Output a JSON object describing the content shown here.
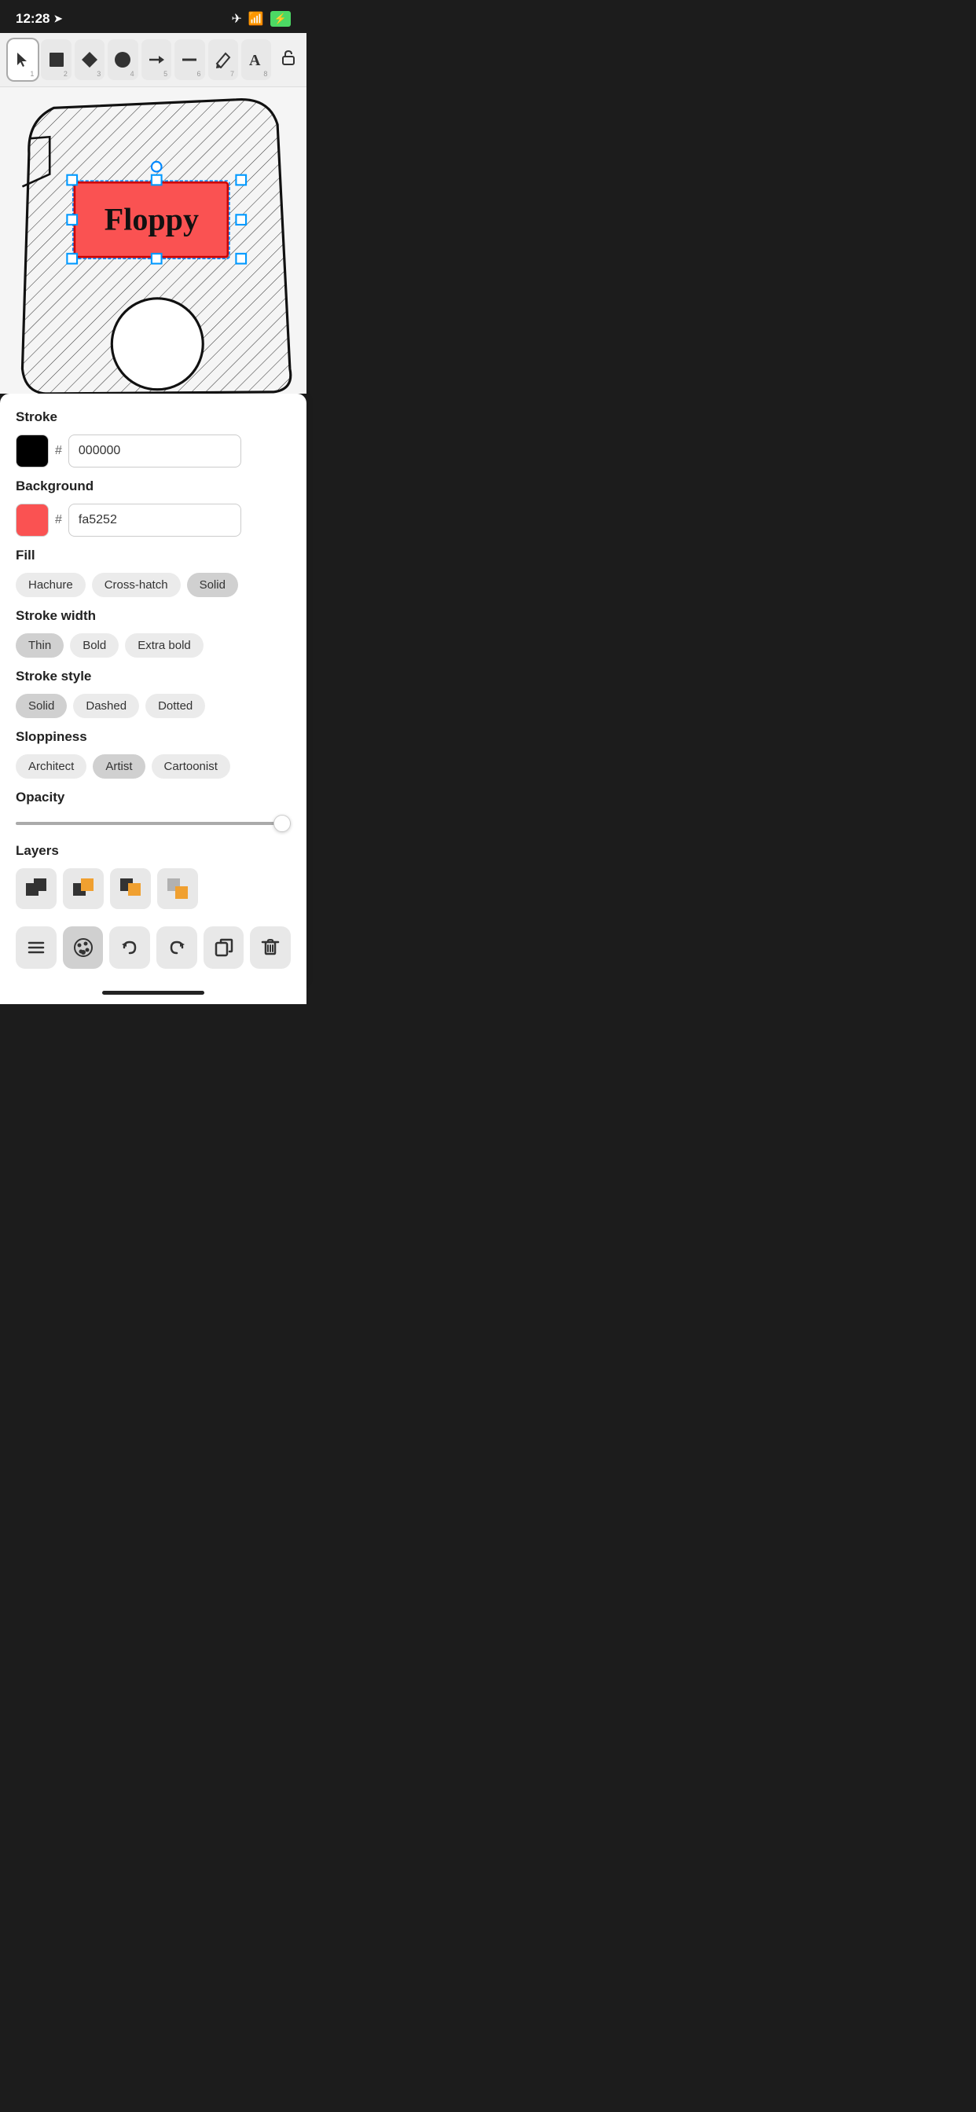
{
  "statusBar": {
    "time": "12:28",
    "locationArrow": "➤"
  },
  "toolbar": {
    "tools": [
      {
        "id": "select",
        "icon": "cursor",
        "num": "1",
        "active": true
      },
      {
        "id": "rect",
        "icon": "square",
        "num": "2"
      },
      {
        "id": "diamond",
        "icon": "diamond",
        "num": "3"
      },
      {
        "id": "ellipse",
        "icon": "circle",
        "num": "4"
      },
      {
        "id": "arrow",
        "icon": "arrow",
        "num": "5"
      },
      {
        "id": "line",
        "icon": "line",
        "num": "6"
      },
      {
        "id": "pencil",
        "icon": "pencil",
        "num": "7"
      },
      {
        "id": "text",
        "icon": "text",
        "num": "8"
      }
    ],
    "lock": "🔓"
  },
  "panel": {
    "stroke": {
      "label": "Stroke",
      "color": "#000000",
      "hex": "000000"
    },
    "background": {
      "label": "Background",
      "color": "#fa5252",
      "hex": "fa5252"
    },
    "fill": {
      "label": "Fill",
      "options": [
        "Hachure",
        "Cross-hatch",
        "Solid"
      ],
      "active": "Solid"
    },
    "strokeWidth": {
      "label": "Stroke width",
      "options": [
        "Thin",
        "Bold",
        "Extra bold"
      ],
      "active": "Thin"
    },
    "strokeStyle": {
      "label": "Stroke style",
      "options": [
        "Solid",
        "Dashed",
        "Dotted"
      ],
      "active": "Solid"
    },
    "sloppiness": {
      "label": "Sloppiness",
      "options": [
        "Architect",
        "Artist",
        "Cartoonist"
      ],
      "active": "Artist"
    },
    "opacity": {
      "label": "Opacity",
      "value": 100
    },
    "layers": {
      "label": "Layers"
    }
  },
  "bottomToolbar": {
    "menu": "≡",
    "palette": "🎨",
    "undo": "↩",
    "redo": "↪",
    "copy": "⧉",
    "delete": "🗑"
  }
}
